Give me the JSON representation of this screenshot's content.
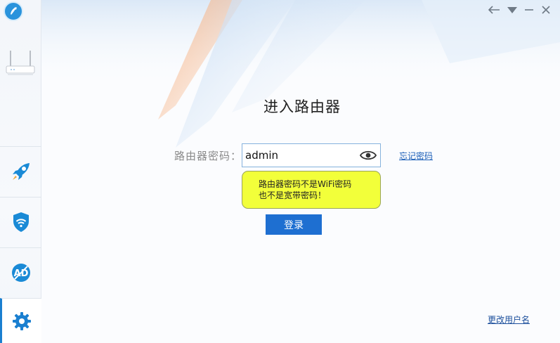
{
  "window": {
    "controls": [
      "back-icon",
      "dropdown-icon",
      "minimize-icon",
      "close-icon"
    ]
  },
  "sidebar": {
    "items": [
      {
        "name": "speedup",
        "icon": "rocket-icon"
      },
      {
        "name": "wifi-security",
        "icon": "wifi-shield-icon"
      },
      {
        "name": "ad-block",
        "icon": "ad-block-icon"
      },
      {
        "name": "settings",
        "icon": "gear-icon"
      }
    ]
  },
  "main": {
    "title": "进入路由器",
    "password_label": "路由器密码：",
    "password_value": "admin",
    "forgot_password": "忘记密码",
    "tip_line1": "路由器密码不是WiFi密码",
    "tip_line2": "也不是宽带密码！",
    "login_button": "登录",
    "change_username": "更改用户名"
  },
  "colors": {
    "accent": "#1e6fd1",
    "tip_background": "#f2ff3a",
    "link": "#1c5fb8"
  }
}
